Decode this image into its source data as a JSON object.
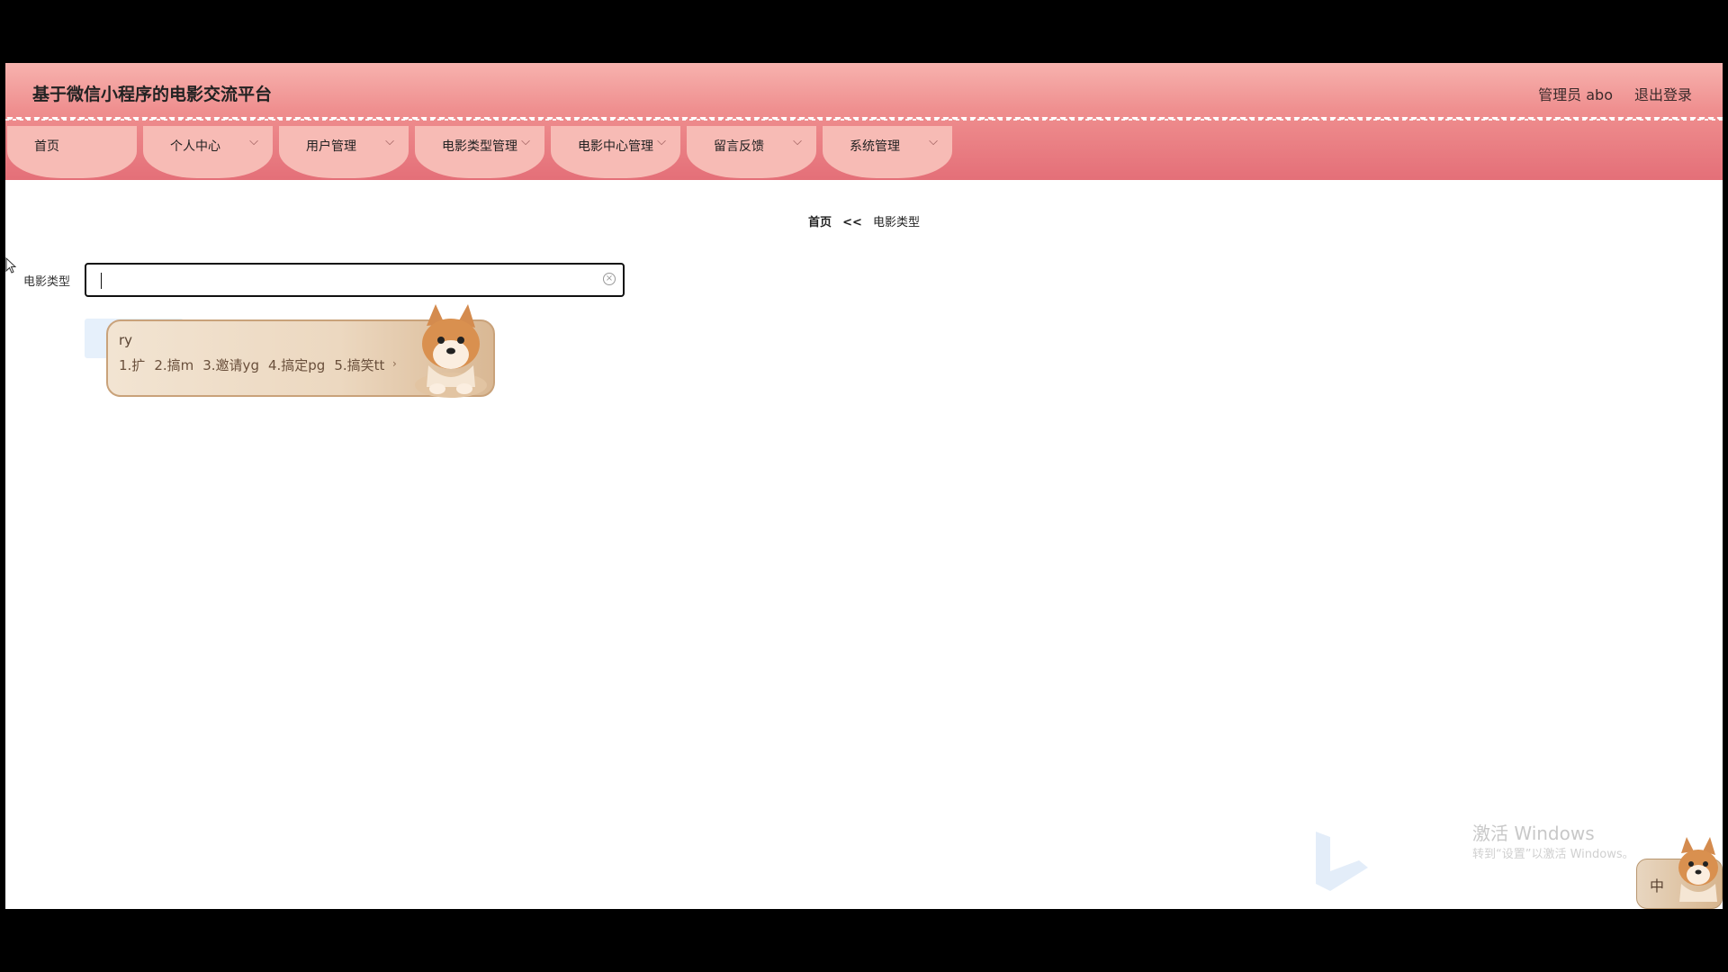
{
  "header": {
    "title": "基于微信小程序的电影交流平台",
    "admin_label": "管理员 abo",
    "logout_label": "退出登录"
  },
  "nav": {
    "items": [
      {
        "label": "首页"
      },
      {
        "label": "个人中心"
      },
      {
        "label": "用户管理"
      },
      {
        "label": "电影类型管理"
      },
      {
        "label": "电影中心管理"
      },
      {
        "label": "留言反馈"
      },
      {
        "label": "系统管理"
      }
    ]
  },
  "breadcrumb": {
    "home": "首页",
    "separator": "<<",
    "current": "电影类型"
  },
  "filter": {
    "label": "电影类型",
    "value": ""
  },
  "ime": {
    "input": "ry",
    "candidates": [
      "1.扩",
      "2.搞m",
      "3.邀请yg",
      "4.搞定pg",
      "5.搞笑tt"
    ],
    "mode": "中"
  },
  "watermark": {
    "line1": "激活 Windows",
    "line2": "转到“设置”以激活 Windows。"
  },
  "colors": {
    "header_top": "#f7b2ae",
    "header_bottom": "#e46f78",
    "nav_tab": "#f7bbb5"
  },
  "icons": [
    "chevron-down-icon",
    "clear-icon",
    "shiba-dog-icon",
    "bing-logo-icon",
    "mouse-cursor-icon"
  ]
}
